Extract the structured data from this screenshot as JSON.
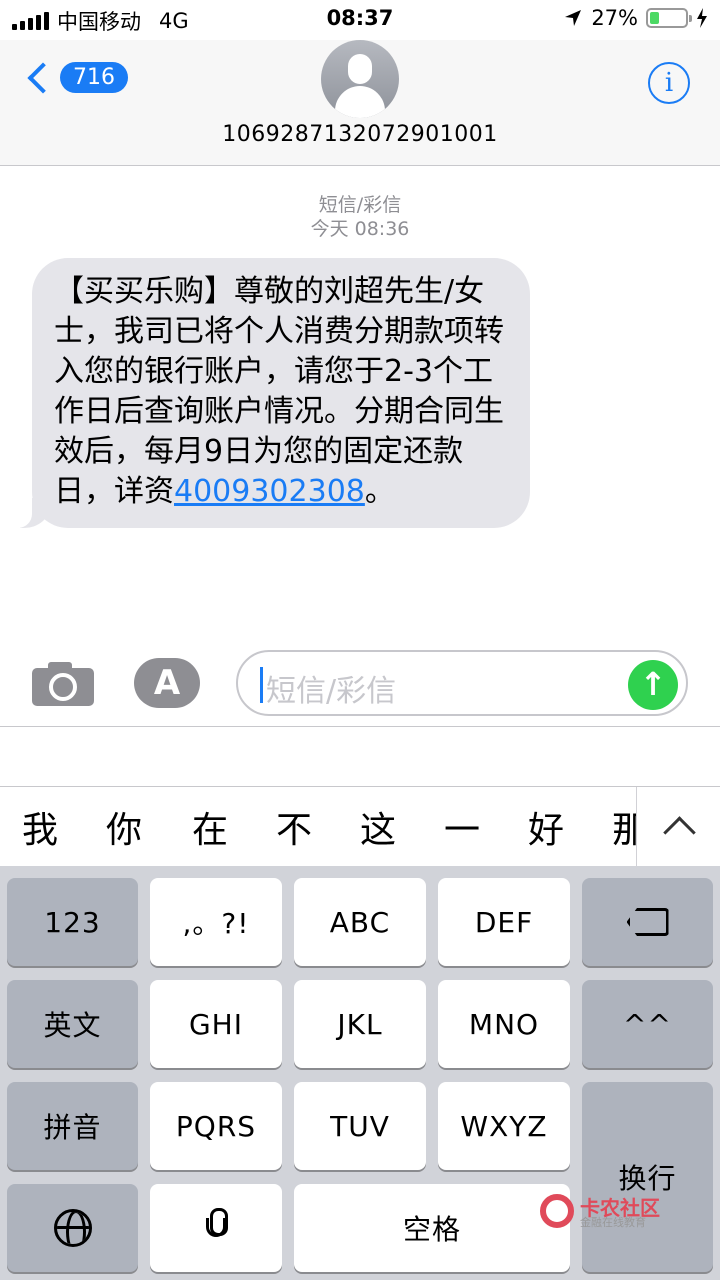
{
  "status_bar": {
    "carrier": "中国移动",
    "network": "4G",
    "time": "08:37",
    "battery_percent": "27%",
    "battery_level": 0.27,
    "accent_color": "#4cd964"
  },
  "header": {
    "back_count": "716",
    "contact": "1069287132072901001",
    "info_glyph": "i"
  },
  "conversation": {
    "message_type": "短信/彩信",
    "timestamp": "今天 08:36",
    "message_text": "【买买乐购】尊敬的刘超先生/女士，我司已将个人消费分期款项转入您的银行账户，请您于2-3个工作日后查询账户情况。分期合同生效后，每月9日为您的固定还款日，详资",
    "message_link": "4009302308",
    "message_end": "。"
  },
  "composer": {
    "placeholder": "短信/彩信",
    "send_glyph": "↑",
    "appstore_glyph": "A"
  },
  "candidates": [
    "我",
    "你",
    "在",
    "不",
    "这",
    "一",
    "好",
    "那"
  ],
  "keyboard": {
    "row1": [
      "123",
      ",。?!",
      "ABC",
      "DEF"
    ],
    "row2": [
      "英文",
      "GHI",
      "JKL",
      "MNO",
      "^^"
    ],
    "row3": [
      "拼音",
      "PQRS",
      "TUV",
      "WXYZ",
      "换行"
    ],
    "space": "空格"
  },
  "watermark": {
    "title": "卡农社区",
    "subtitle": "金融在线教育"
  },
  "colors": {
    "ios_blue": "#1a7cf5",
    "bubble_gray": "#e5e5ea",
    "send_green": "#2fd14f"
  },
  "icons": [
    "location-arrow-icon",
    "charging-icon",
    "back-chevron-icon",
    "avatar-icon",
    "info-icon",
    "camera-icon",
    "appstore-icon",
    "send-icon",
    "delete-icon",
    "globe-icon",
    "mic-icon",
    "expand-icon"
  ]
}
